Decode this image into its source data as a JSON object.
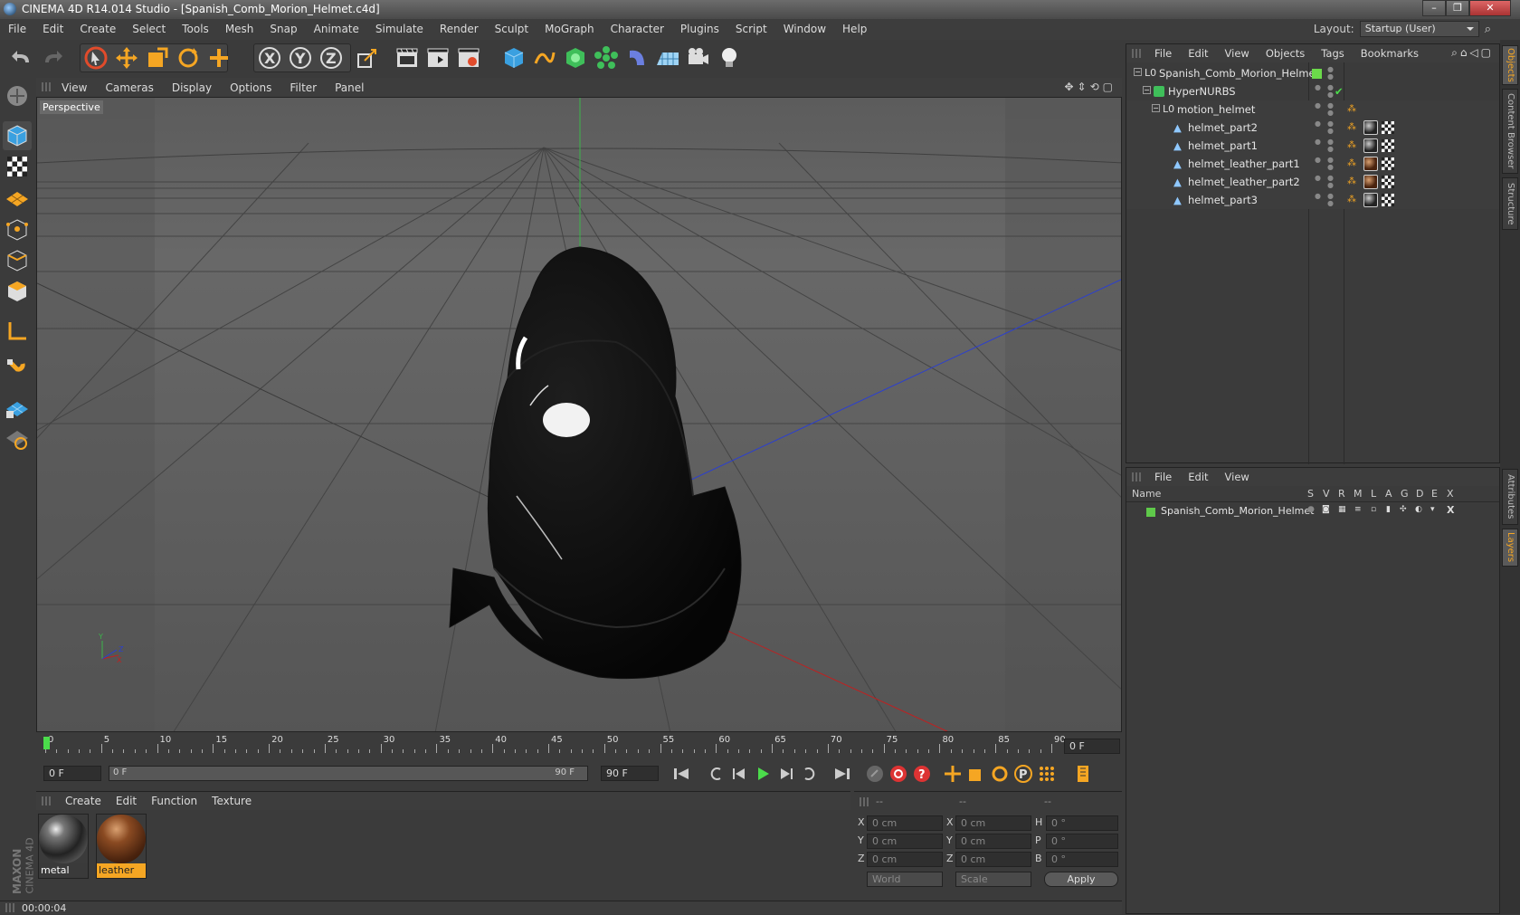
{
  "window": {
    "title": "CINEMA 4D R14.014 Studio - [Spanish_Comb_Morion_Helmet.c4d]",
    "minimize": "–",
    "maximize": "❐",
    "close": "✕"
  },
  "menubar": {
    "items": [
      "File",
      "Edit",
      "Create",
      "Select",
      "Tools",
      "Mesh",
      "Snap",
      "Animate",
      "Simulate",
      "Render",
      "Sculpt",
      "MoGraph",
      "Character",
      "Plugins",
      "Script",
      "Window",
      "Help"
    ],
    "layout_label": "Layout:",
    "layout_value": "Startup (User)"
  },
  "viewport": {
    "menu": [
      "View",
      "Cameras",
      "Display",
      "Options",
      "Filter",
      "Panel"
    ],
    "label": "Perspective",
    "axis_y": "Y",
    "axis_z": "Z",
    "axis_x": "X"
  },
  "timeline": {
    "ticks": [
      "0",
      "5",
      "10",
      "15",
      "20",
      "25",
      "30",
      "35",
      "40",
      "45",
      "50",
      "55",
      "60",
      "65",
      "70",
      "75",
      "80",
      "85",
      "90"
    ],
    "current_frame": "0 F"
  },
  "playbar": {
    "start_field": "0 F",
    "range_start": "0 F",
    "range_end": "90 F",
    "end_field": "90 F"
  },
  "materials": {
    "menu": [
      "Create",
      "Edit",
      "Function",
      "Texture"
    ],
    "items": [
      {
        "label": "metal"
      },
      {
        "label": "leather"
      }
    ]
  },
  "coords": {
    "headers": [
      "--",
      "--",
      "--"
    ],
    "rows": [
      {
        "a": "X",
        "av": "0 cm",
        "b": "X",
        "bv": "0 cm",
        "c": "H",
        "cv": "0 °"
      },
      {
        "a": "Y",
        "av": "0 cm",
        "b": "Y",
        "bv": "0 cm",
        "c": "P",
        "cv": "0 °"
      },
      {
        "a": "Z",
        "av": "0 cm",
        "b": "Z",
        "bv": "0 cm",
        "c": "B",
        "cv": "0 °"
      }
    ],
    "world": "World",
    "scale": "Scale",
    "apply": "Apply"
  },
  "status": {
    "time": "00:00:04"
  },
  "branding": {
    "maxon": "MAXON",
    "cinema": "CINEMA 4D"
  },
  "objects": {
    "menu": [
      "File",
      "Edit",
      "View",
      "Objects",
      "Tags",
      "Bookmarks"
    ],
    "rows": [
      {
        "name": "Spanish_Comb_Morion_Helmet"
      },
      {
        "name": "HyperNURBS"
      },
      {
        "name": "motion_helmet"
      },
      {
        "name": "helmet_part2"
      },
      {
        "name": "helmet_part1"
      },
      {
        "name": "helmet_leather_part1"
      },
      {
        "name": "helmet_leather_part2"
      },
      {
        "name": "helmet_part3"
      }
    ]
  },
  "layers": {
    "menu": [
      "File",
      "Edit",
      "View"
    ],
    "col_name": "Name",
    "cols": [
      "S",
      "V",
      "R",
      "M",
      "L",
      "A",
      "G",
      "D",
      "E",
      "X"
    ],
    "row_name": "Spanish_Comb_Morion_Helmet",
    "layer_color": "#5fc94a"
  },
  "side_tabs": [
    "Objects",
    "Content Browser",
    "Structure",
    "Attributes",
    "Layers"
  ],
  "colors": {
    "accent": "#f5a623",
    "green": "#4bdc4b"
  }
}
